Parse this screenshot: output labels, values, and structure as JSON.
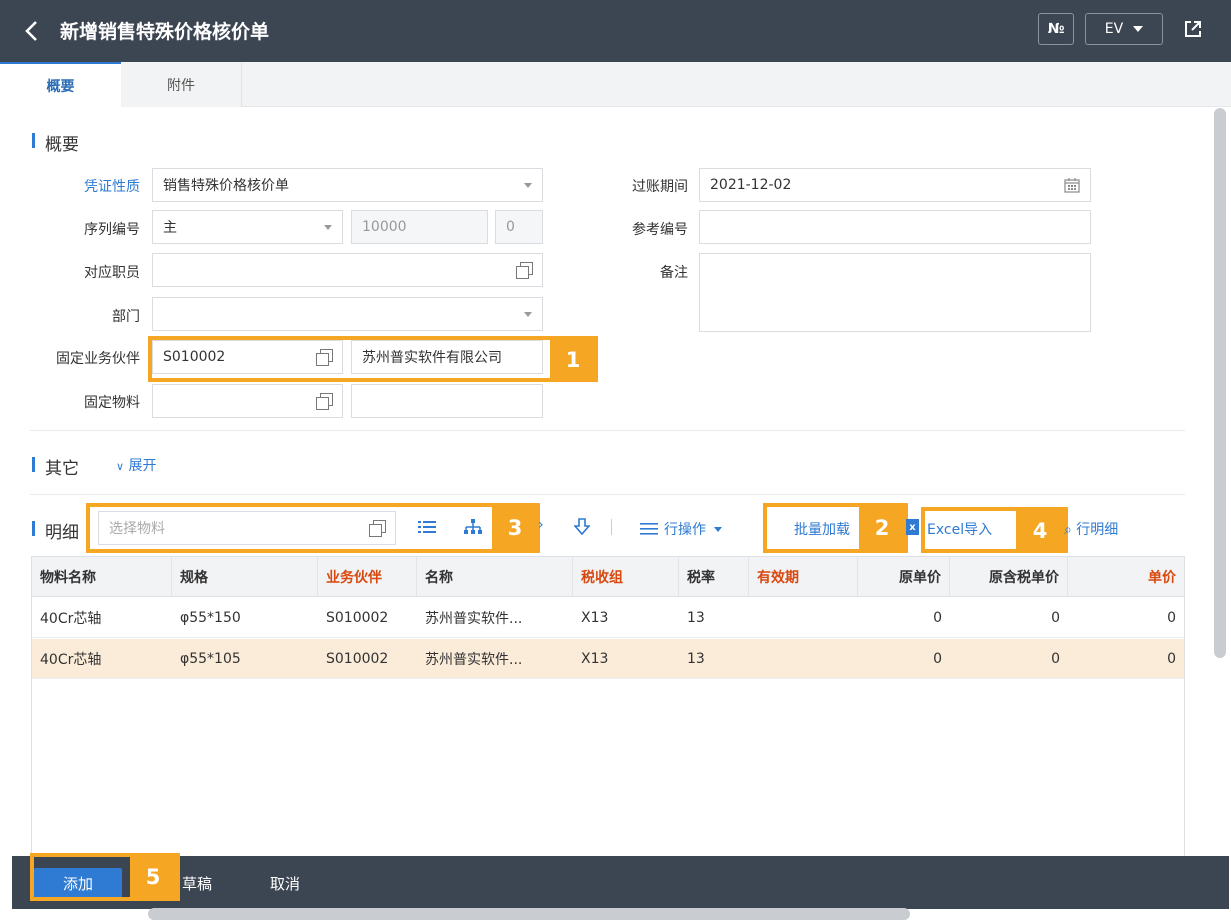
{
  "header": {
    "title": "新增销售特殊价格核价单",
    "no_button": "№",
    "lang_button": "EV"
  },
  "tabs": [
    {
      "label": "概要"
    },
    {
      "label": "附件"
    }
  ],
  "summary": {
    "title": "概要",
    "voucher_type_label": "凭证性质",
    "voucher_type_value": "销售特殊价格核价单",
    "posting_period_label": "过账期间",
    "posting_period_value": "2021-12-02",
    "serial_label": "序列编号",
    "serial_value": "主",
    "serial_number": "10000",
    "serial_suffix": "0",
    "reference_label": "参考编号",
    "reference_value": "",
    "employee_label": "对应职员",
    "employee_value": "",
    "remark_label": "备注",
    "remark_value": "",
    "department_label": "部门",
    "department_value": "",
    "partner_label": "固定业务伙伴",
    "partner_code": "S010002",
    "partner_name": "苏州普实软件有限公司",
    "material_label": "固定物料",
    "material_code": "",
    "material_name": ""
  },
  "other": {
    "title": "其它",
    "expand_label": "展开"
  },
  "detail": {
    "title": "明细",
    "select_material_placeholder": "选择物料",
    "row_ops_label": "行操作",
    "batch_load_label": "批量加载",
    "excel_import_label": "Excel导入",
    "row_detail_label": "行明细"
  },
  "grid": {
    "columns": [
      "物料名称",
      "规格",
      "业务伙伴",
      "名称",
      "税收组",
      "税率",
      "有效期",
      "原单价",
      "原含税单价",
      "单价"
    ],
    "rows": [
      [
        "40Cr芯轴",
        "φ55*150",
        "S010002",
        "苏州普实软件...",
        "X13",
        "13",
        "",
        "0",
        "0",
        "0"
      ],
      [
        "40Cr芯轴",
        "φ55*105",
        "S010002",
        "苏州普实软件...",
        "X13",
        "13",
        "",
        "0",
        "0",
        "0"
      ]
    ]
  },
  "callouts": [
    "1",
    "2",
    "3",
    "4",
    "5"
  ],
  "footer": {
    "add_label": "添加",
    "draft_label": "草稿",
    "cancel_label": "取消"
  },
  "colors": {
    "header_bg": "#3c4552",
    "accent": "#2f7ad3",
    "callout": "#f5a623",
    "required_red": "#d9480f",
    "selected_row": "#fbecd9"
  }
}
